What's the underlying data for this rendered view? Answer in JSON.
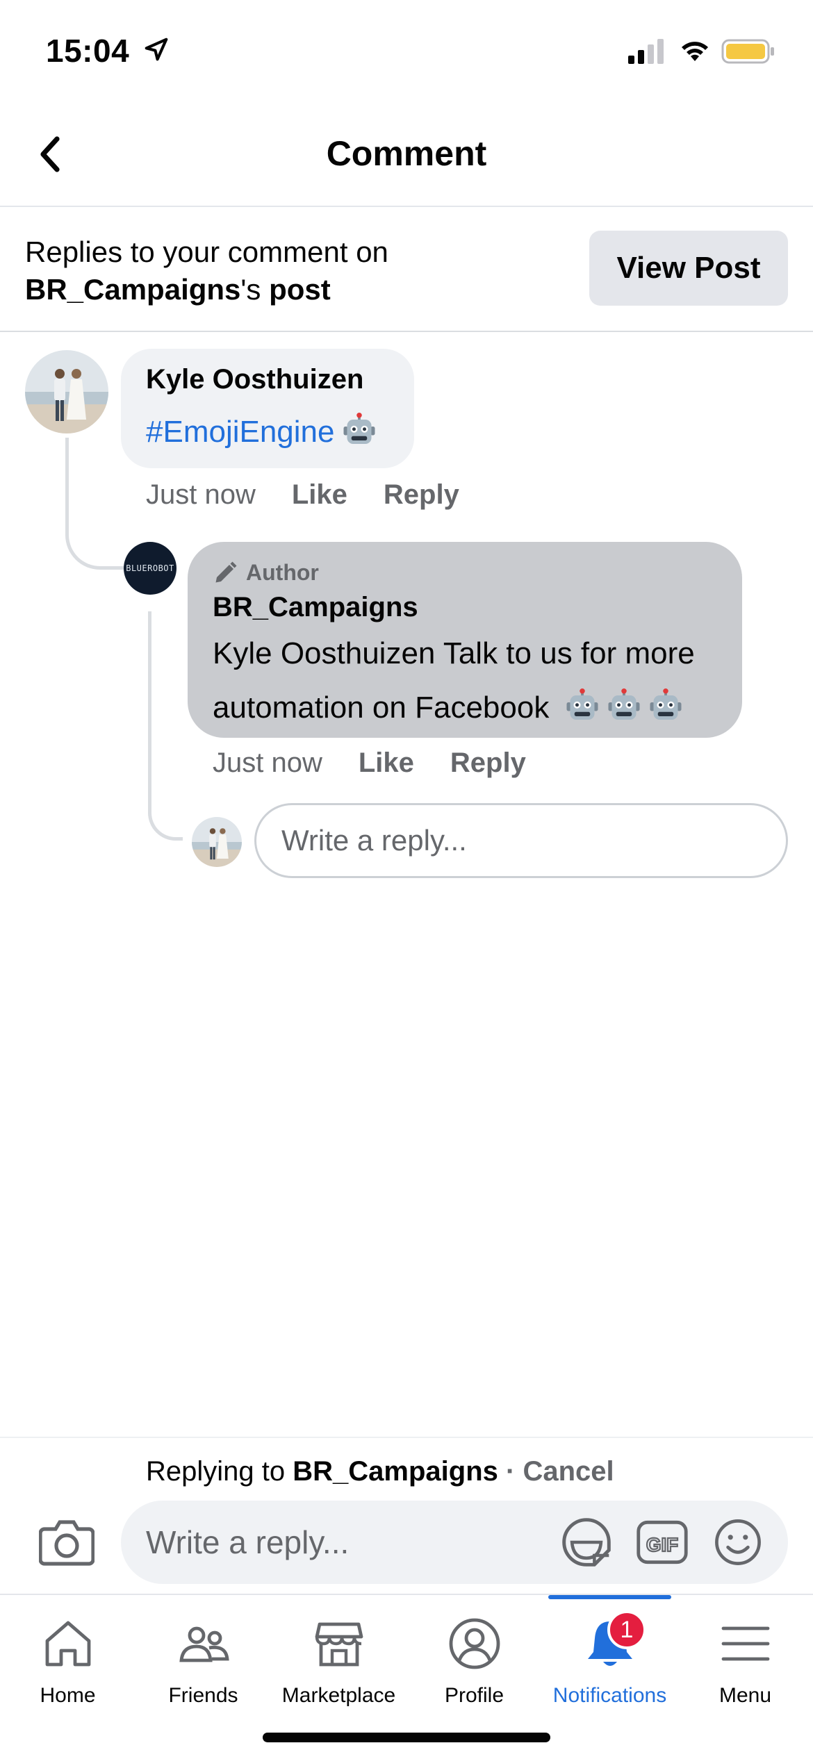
{
  "status_bar": {
    "time": "15:04"
  },
  "header": {
    "title": "Comment"
  },
  "context": {
    "line_prefix": "Replies to your comment on",
    "page_name": "BR_Campaigns",
    "possessive": "'s",
    "post_word": "post",
    "view_post_label": "View Post"
  },
  "comment": {
    "author": "Kyle Oosthuizen",
    "hashtag": "#EmojiEngine",
    "time": "Just now",
    "like_label": "Like",
    "reply_label": "Reply"
  },
  "reply": {
    "badge": "Author",
    "avatar_text": "BLUEROBOT",
    "author": "BR_Campaigns",
    "text": "Kyle Oosthuizen Talk to us for more automation on Facebook",
    "time": "Just now",
    "like_label": "Like",
    "reply_label": "Reply"
  },
  "inline_reply": {
    "placeholder": "Write a reply..."
  },
  "composer": {
    "replying_prefix": "Replying to",
    "replying_name": "BR_Campaigns",
    "separator": "·",
    "cancel_label": "Cancel",
    "placeholder": "Write a reply..."
  },
  "tabs": [
    {
      "label": "Home",
      "icon": "home-icon"
    },
    {
      "label": "Friends",
      "icon": "friends-icon"
    },
    {
      "label": "Marketplace",
      "icon": "marketplace-icon"
    },
    {
      "label": "Profile",
      "icon": "profile-icon"
    },
    {
      "label": "Notifications",
      "icon": "bell-icon",
      "active": true,
      "badge": "1"
    },
    {
      "label": "Menu",
      "icon": "menu-icon"
    }
  ],
  "colors": {
    "link_blue": "#216fdb",
    "badge_red": "#e41e3f",
    "author_bubble": "#c9cbcf",
    "comment_bubble": "#f0f2f5",
    "battery_yellow": "#f5c842"
  }
}
